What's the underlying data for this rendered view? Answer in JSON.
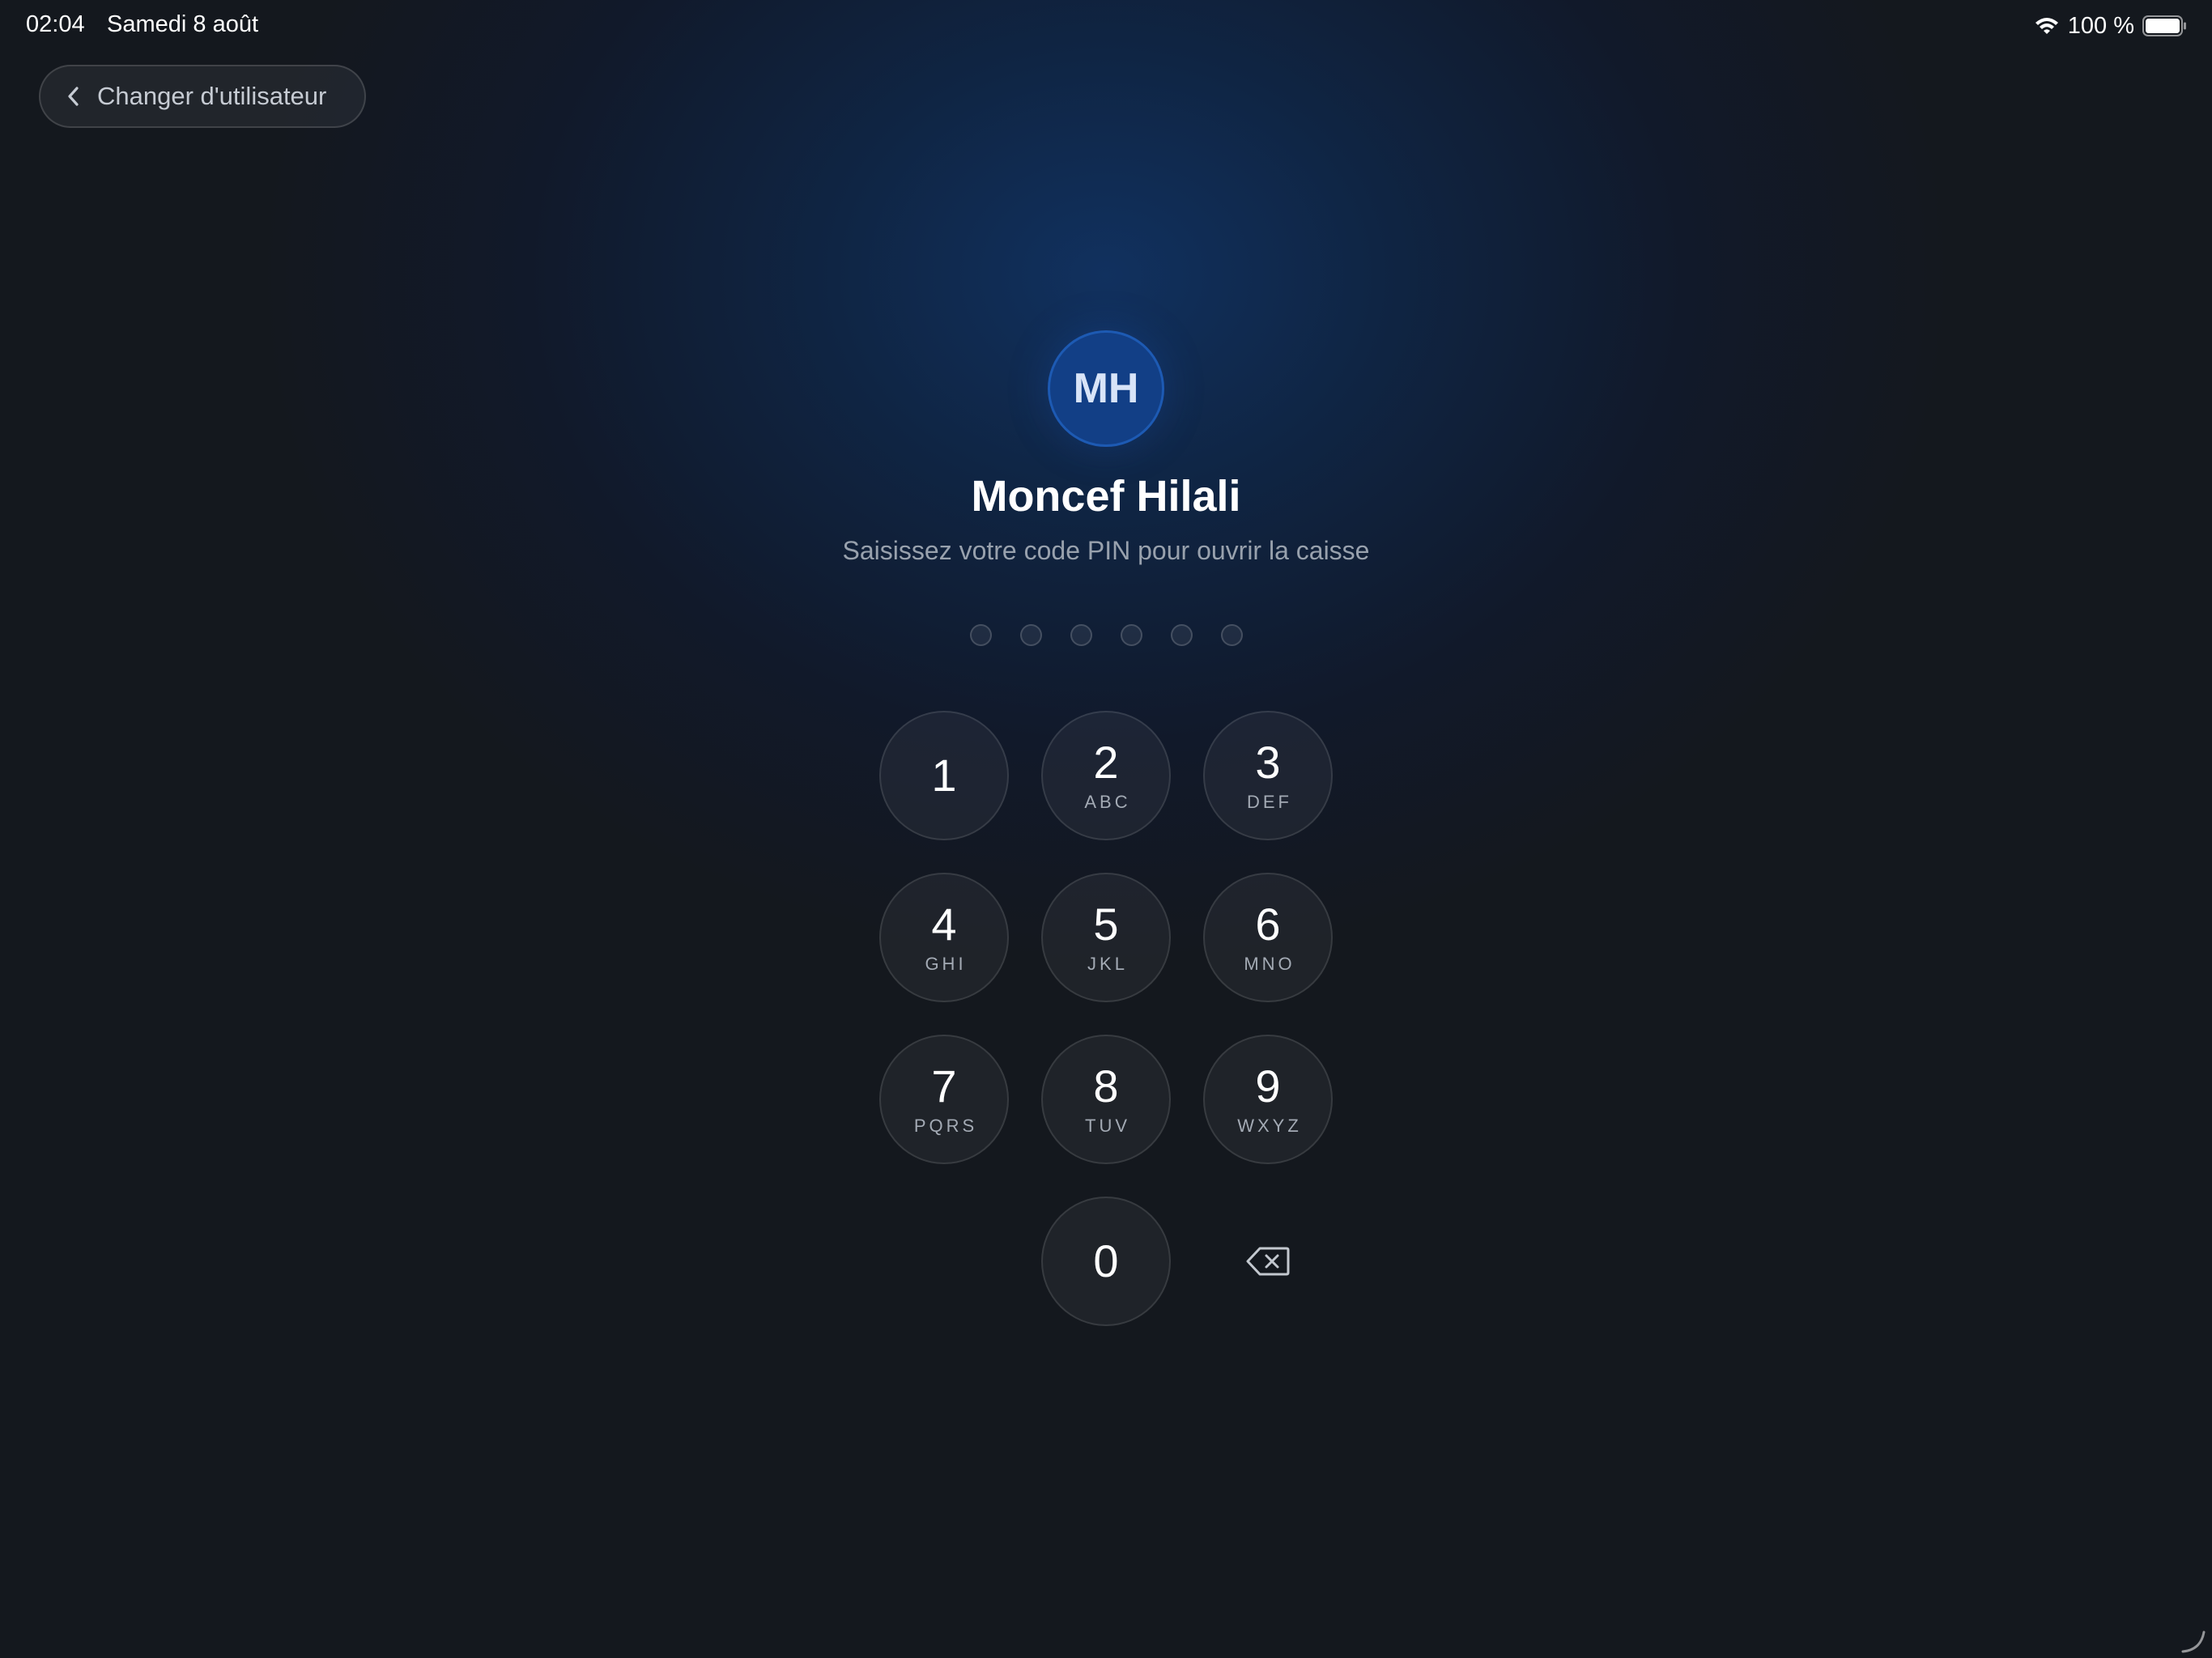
{
  "status_bar": {
    "time": "02:04",
    "date": "Samedi 8 août",
    "battery_text": "100 %",
    "icons": [
      "wifi-icon",
      "battery-icon"
    ]
  },
  "back_button": {
    "label": "Changer d'utilisateur",
    "icon": "chevron-left-icon"
  },
  "user": {
    "initials": "MH",
    "name": "Moncef Hilali",
    "prompt": "Saisissez votre code PIN pour ouvrir la caisse"
  },
  "pin": {
    "length": 6,
    "entered": 0
  },
  "keypad": {
    "keys": [
      {
        "digit": "1",
        "letters": ""
      },
      {
        "digit": "2",
        "letters": "ABC"
      },
      {
        "digit": "3",
        "letters": "DEF"
      },
      {
        "digit": "4",
        "letters": "GHI"
      },
      {
        "digit": "5",
        "letters": "JKL"
      },
      {
        "digit": "6",
        "letters": "MNO"
      },
      {
        "digit": "7",
        "letters": "PQRS"
      },
      {
        "digit": "8",
        "letters": "TUV"
      },
      {
        "digit": "9",
        "letters": "WXYZ"
      },
      {
        "digit": "0",
        "letters": ""
      }
    ],
    "delete_icon": "backspace-icon"
  },
  "colors": {
    "background": "#14181e",
    "glow": "#11315f",
    "avatar_fill": "#123f86",
    "avatar_border": "#1d5ab3",
    "subtitle": "#98a1ad"
  }
}
